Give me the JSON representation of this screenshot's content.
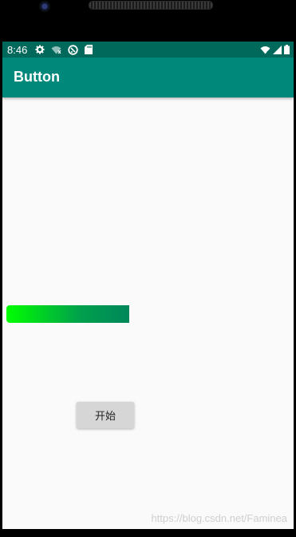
{
  "status_bar": {
    "time": "8:46",
    "left_icons": [
      "gear-icon",
      "wifi-off-icon",
      "sync-icon",
      "sd-card-icon"
    ],
    "right_icons": [
      "wifi-icon",
      "signal-icon",
      "battery-icon"
    ]
  },
  "app_bar": {
    "title": "Button"
  },
  "progress": {
    "value_fraction": 1.0
  },
  "start_button": {
    "label": "开始"
  },
  "watermark": {
    "text": "https://blog.csdn.net/Faminea"
  },
  "colors": {
    "status_bar": "#00695c",
    "app_bar": "#00897b",
    "progress_start": "#00ff00",
    "progress_end": "#00875a",
    "content_bg": "#fafafa"
  }
}
